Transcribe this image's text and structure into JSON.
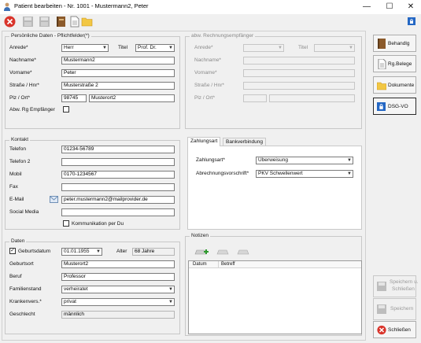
{
  "window": {
    "title": "Patient bearbeiten - Nr. 1001 - Mustermann2, Peter",
    "minimize": "—",
    "maximize": "☐",
    "close": "✕"
  },
  "personal": {
    "title": "Persönliche Daten - Pflichtfelder(*)",
    "anrede_label": "Anrede*",
    "anrede_value": "Herr",
    "titel_label": "Titel",
    "titel_value": "Prof. Dr.",
    "nachname_label": "Nachname*",
    "nachname_value": "Mustermann2",
    "vorname_label": "Vorname*",
    "vorname_value": "Peter",
    "strasse_label": "Straße / Hnr*",
    "strasse_value": "Musterstraße 2",
    "plz_label": "Plz / Ort*",
    "plz_value": "98745",
    "ort_value": "Musterort2",
    "abw_label": "Abw. Rg Empfänger"
  },
  "billing": {
    "title": "abw. Rechnungsempfänger",
    "anrede_label": "Anrede*",
    "titel_label": "Titel",
    "nachname_label": "Nachname*",
    "vorname_label": "Vorname*",
    "strasse_label": "Straße / Hnr*",
    "plz_label": "Plz / Ort*"
  },
  "contact": {
    "title": "Kontakt",
    "telefon_label": "Telefon",
    "telefon_value": "01234-56789",
    "telefon2_label": "Telefon 2",
    "telefon2_value": "",
    "mobil_label": "Mobil",
    "mobil_value": "0170-1234567",
    "fax_label": "Fax",
    "fax_value": "",
    "email_label": "E-Mail",
    "email_value": "peter.mustermann2@mailprovider.de",
    "social_label": "Social Media",
    "social_value": "",
    "komm_label": "Kommunikation per Du"
  },
  "payment": {
    "tab1": "Zahlungsart",
    "tab2": "Bankverbindung",
    "zahlungsart_label": "Zahlungsart*",
    "zahlungsart_value": "Überweisung",
    "abrechnung_label": "Abrechnungsvorschrift*",
    "abrechnung_value": "PKV Schwellenwert"
  },
  "daten": {
    "title": "Daten",
    "geburtsdatum_label": "Geburtsdatum",
    "geburtsdatum_value": "01.01.1955",
    "alter_label": "Alter",
    "alter_value": "68 Jahre",
    "geburtsort_label": "Geburtsort",
    "geburtsort_value": "Musterort2",
    "beruf_label": "Beruf",
    "beruf_value": "Professor",
    "familienstand_label": "Familienstand",
    "familienstand_value": "verheiratet",
    "krankenvers_label": "Krankenvers.*",
    "krankenvers_value": "privat",
    "geschlecht_label": "Geschlecht",
    "geschlecht_value": "männlich"
  },
  "notes": {
    "title": "Notizen",
    "col_datum": "Datum",
    "col_betreff": "Betreff"
  },
  "right_buttons": {
    "behandlung": "Behandlg",
    "belege": "Rg.Belege",
    "dokumente": "Dokumente",
    "dsgvo": "DSG-VO",
    "speichern_schliessen_1": "Speichern u.",
    "speichern_schliessen_2": "Schließen",
    "speichern": "Speichern",
    "schliessen": "Schließen"
  },
  "colors": {
    "close_red": "#d9342b",
    "book_brown": "#8b5a2b",
    "folder_yellow": "#f2c744",
    "lock_blue": "#2467c4"
  }
}
